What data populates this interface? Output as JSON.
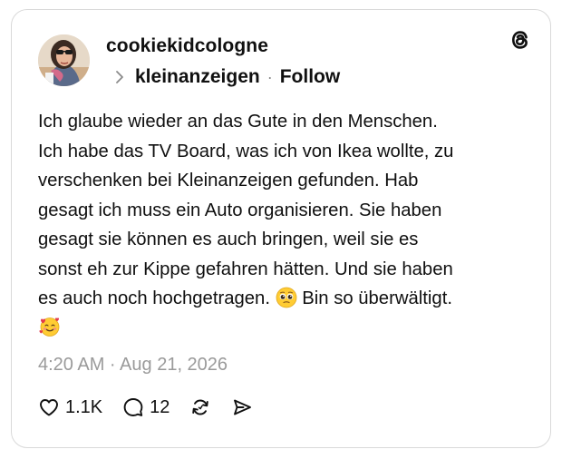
{
  "post": {
    "username": "cookiekidcologne",
    "community": "kleinanzeigen",
    "separator": "·",
    "follow_label": "Follow",
    "body_lines": [
      "Ich glaube wieder an das Gute in den Menschen.",
      "Ich habe das TV Board, was ich von Ikea wollte, zu",
      "verschenken bei Kleinanzeigen gefunden. Hab",
      "gesagt ich muss ein Auto organisieren. Sie haben",
      "gesagt sie können es auch bringen, weil sie es",
      "sonst eh zur Kippe gefahren hätten. Und sie haben"
    ],
    "body_line_7_before_emoji": "es auch noch hochgetragen.",
    "body_line_7_after_emoji": "Bin so überwältigt.",
    "emoji_pleading": "pleading-face-emoji",
    "emoji_hearts": "smiling-face-with-hearts-emoji",
    "timestamp": "4:20 AM · Aug 21, 2026",
    "likes": "1.1K",
    "replies": "12"
  },
  "icons": {
    "logo": "threads-logo-icon",
    "like": "heart-icon",
    "reply": "comment-icon",
    "repost": "repost-icon",
    "share": "send-icon"
  },
  "colors": {
    "text": "#101010",
    "muted": "#9a9a9a",
    "border": "#d9d9d9"
  }
}
